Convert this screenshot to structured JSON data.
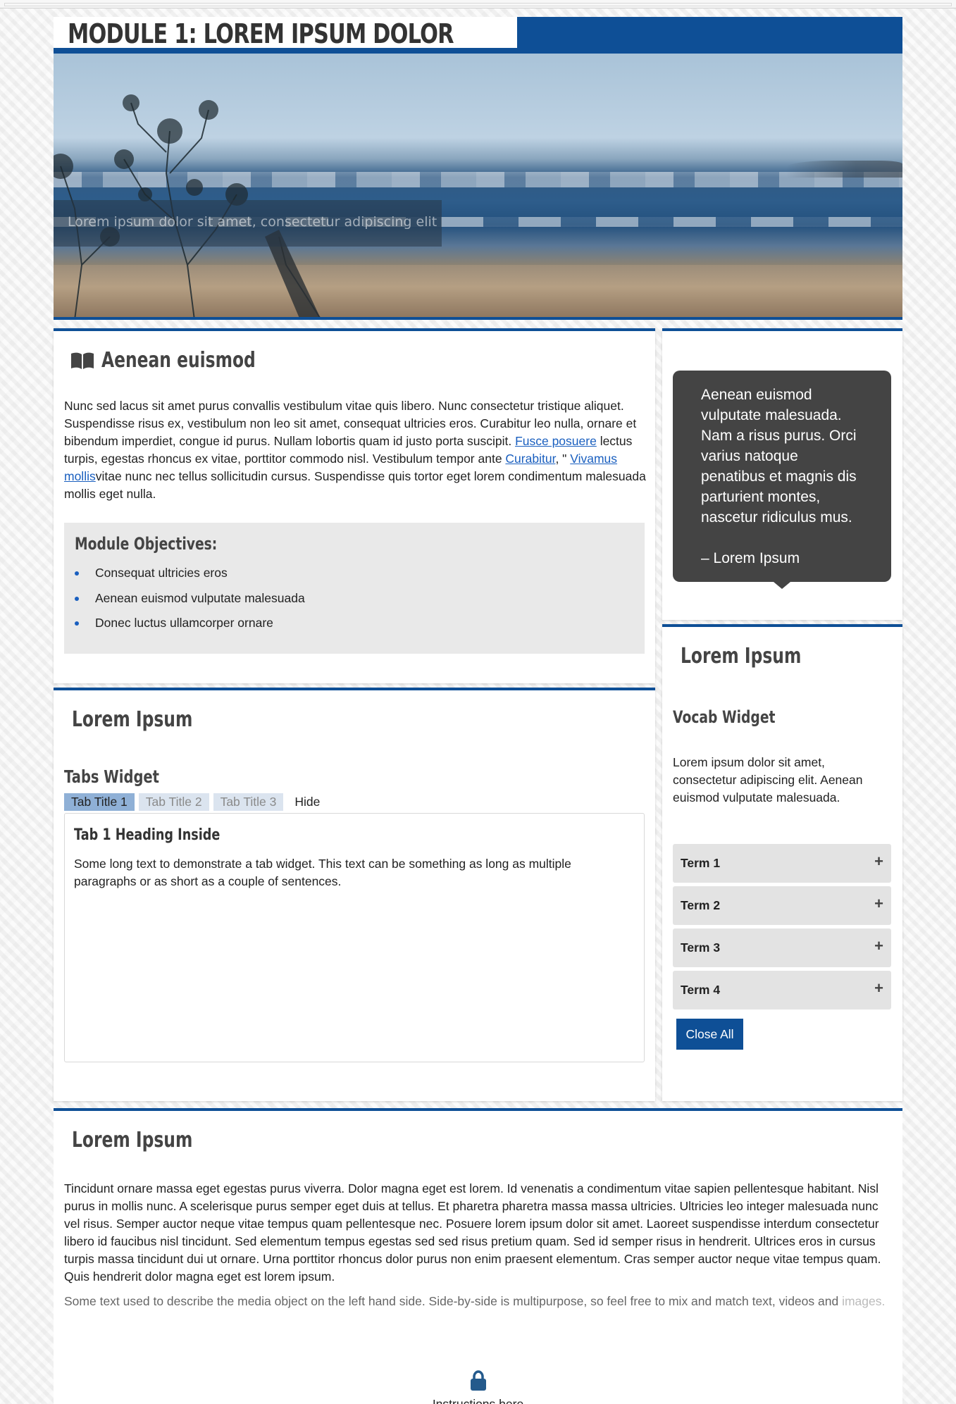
{
  "page_title": "MODULE 1: LOREM IPSUM DOLOR",
  "hero": {
    "caption": "Lorem ipsum dolor sit amet, consectetur adipiscing elit"
  },
  "intro": {
    "heading": "Aenean euismod",
    "text_1": "Nunc sed lacus sit amet purus convallis vestibulum vitae quis libero. Nunc consectetur tristique aliquet. Suspendisse risus ex, vestibulum non leo sit amet, consequat ultricies eros. Curabitur leo nulla, ornare et bibendum imperdiet, congue id purus. Nullam lobortis quam id justo porta suscipit. ",
    "link_1": "Fusce posuere",
    "text_2": " lectus turpis, egestas rhoncus ex vitae, porttitor commodo nisl. Vestibulum tempor ante ",
    "link_2": "Curabitur",
    "text_3": ", \" ",
    "link_3": "Vivamus mollis",
    "text_4": "vitae nunc nec tellus sollicitudin cursus. Suspendisse quis tortor eget lorem condimentum malesuada mollis eget nulla."
  },
  "objectives": {
    "title": "Module Objectives:",
    "items": [
      "Consequat ultricies eros",
      "Aenean euismod vulputate malesuada",
      "Donec luctus ullamcorper ornare"
    ]
  },
  "tabs_section": {
    "heading": "Lorem Ipsum",
    "widget_title": "Tabs Widget",
    "tabs": [
      "Tab Title 1",
      "Tab Title 2",
      "Tab Title 3",
      "Hide"
    ],
    "active_heading": "Tab 1 Heading Inside",
    "active_text": "Some long text to demonstrate a tab widget. This text can be something as long as multiple paragraphs or as short as a couple of sentences."
  },
  "quote": {
    "text": "Aenean euismod vulputate malesuada. Nam a risus purus. Orci varius natoque penatibus et magnis dis parturient montes, nascetur ridiculus mus.",
    "author": "– Lorem Ipsum"
  },
  "vocab_section": {
    "heading": "Lorem Ipsum",
    "widget_title": "Vocab Widget",
    "text": "Lorem ipsum dolor sit amet, consectetur adipiscing elit. Aenean euismod vulputate malesuada.",
    "terms": [
      "Term 1",
      "Term 2",
      "Term 3",
      "Term 4"
    ],
    "term_icon": "+",
    "close_all": "Close All"
  },
  "bottom_section": {
    "heading": "Lorem Ipsum",
    "text": "Tincidunt ornare massa eget egestas purus viverra. Dolor magna eget est lorem. Id venenatis a condimentum vitae sapien pellentesque habitant. Nisl purus in mollis nunc. A scelerisque purus semper eget duis at tellus. Et pharetra pharetra massa massa ultricies. Ultricies leo integer malesuada nunc vel risus. Semper auctor neque vitae tempus quam pellentesque nec. Posuere lorem ipsum dolor sit amet. Laoreet suspendisse interdum consectetur libero id faucibus nisl tincidunt. Sed elementum tempus egestas sed sed risus pretium quam. Sed id semper risus in hendrerit. Ultrices eros in cursus turpis massa tincidunt dui ut ornare. Urna porttitor rhoncus dolor purus non enim praesent elementum. Cras semper auctor neque vitae tempus quam. Quis hendrerit dolor magna eget est lorem ipsum.",
    "media_text": "Some text used to describe the media object on the left hand side. Side-by-side is multipurpose, so feel free to mix and match text, videos and ",
    "media_text_fade": "images.",
    "instructions": "Instructions here"
  },
  "colors": {
    "brand_blue": "#0e4f96",
    "link": "#1a5fbf",
    "quote_bg": "#444444"
  },
  "icons": {
    "intro": "book-icon",
    "instructions": "lock-icon"
  }
}
